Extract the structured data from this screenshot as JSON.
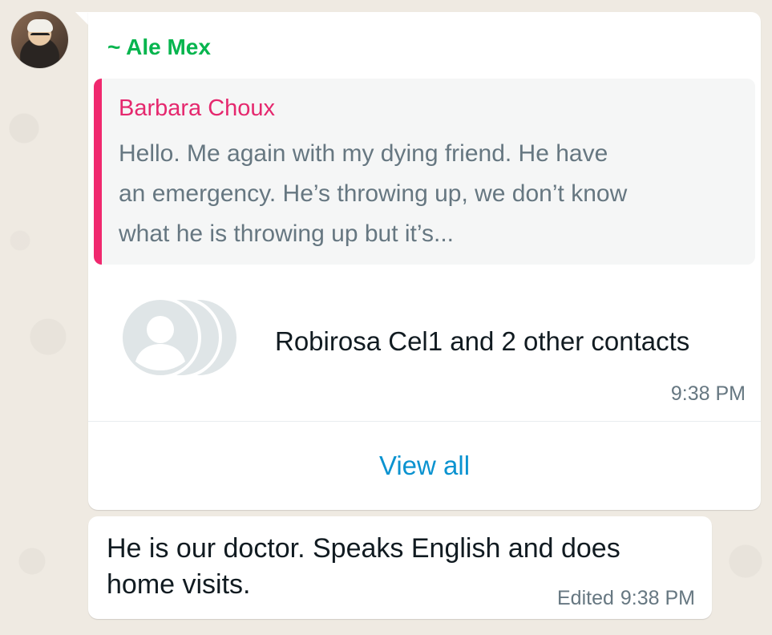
{
  "message1": {
    "sender": "~ Ale Mex",
    "quoted": {
      "author": "Barbara Choux",
      "text": "Hello. Me again with my dying friend. He have an emergency. He’s throwing up, we don’t know what he is throwing up but it’s..."
    },
    "contact_card": {
      "icon": "contacts-stack-icon",
      "label": "Robirosa Cel1 and 2 other contacts"
    },
    "time": "9:38 PM",
    "view_all_label": "View all"
  },
  "message2": {
    "text": "He is our doctor. Speaks English and does home visits.",
    "edited_label": "Edited",
    "time": "9:38 PM"
  },
  "colors": {
    "sender": "#06b54e",
    "quote_author": "#e5286e",
    "quote_bar": "#f0286e",
    "link": "#0b93d0",
    "background": "#efeae2"
  }
}
